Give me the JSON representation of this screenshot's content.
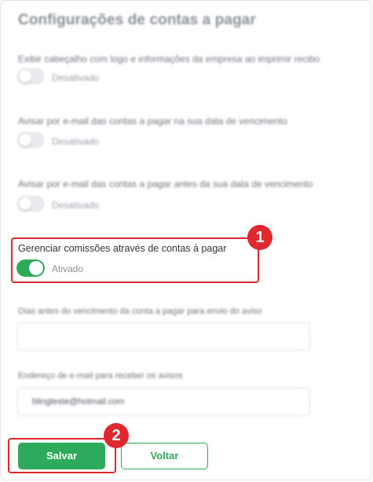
{
  "page": {
    "title": "Configurações de contas a pagar"
  },
  "settings": [
    {
      "label": "Exibir cabeçalho com logo e informações da empresa ao imprimir recibo",
      "status": "Desativado",
      "enabled": false
    },
    {
      "label": "Avisar por e-mail das contas a pagar na sua data de vencimento",
      "status": "Desativado",
      "enabled": false
    },
    {
      "label": "Avisar por e-mail das contas a pagar antes da sua data de vencimento",
      "status": "Desativado",
      "enabled": false
    },
    {
      "label": "Gerenciar comissões através de contas à pagar",
      "status": "Ativado",
      "enabled": true
    }
  ],
  "fields": {
    "days_before": {
      "label": "Dias antes do vencimento da conta a pagar para envio do aviso",
      "value": ""
    },
    "email": {
      "label": "Endereço de e-mail para receber os avisos",
      "value": "blingteste@hotmail.com"
    }
  },
  "buttons": {
    "save_label": "Salvar",
    "back_label": "Voltar"
  },
  "annotations": {
    "step1": "1",
    "step2": "2"
  },
  "colors": {
    "accent_green": "#2eaa5b",
    "highlight_red": "#e0282e"
  }
}
